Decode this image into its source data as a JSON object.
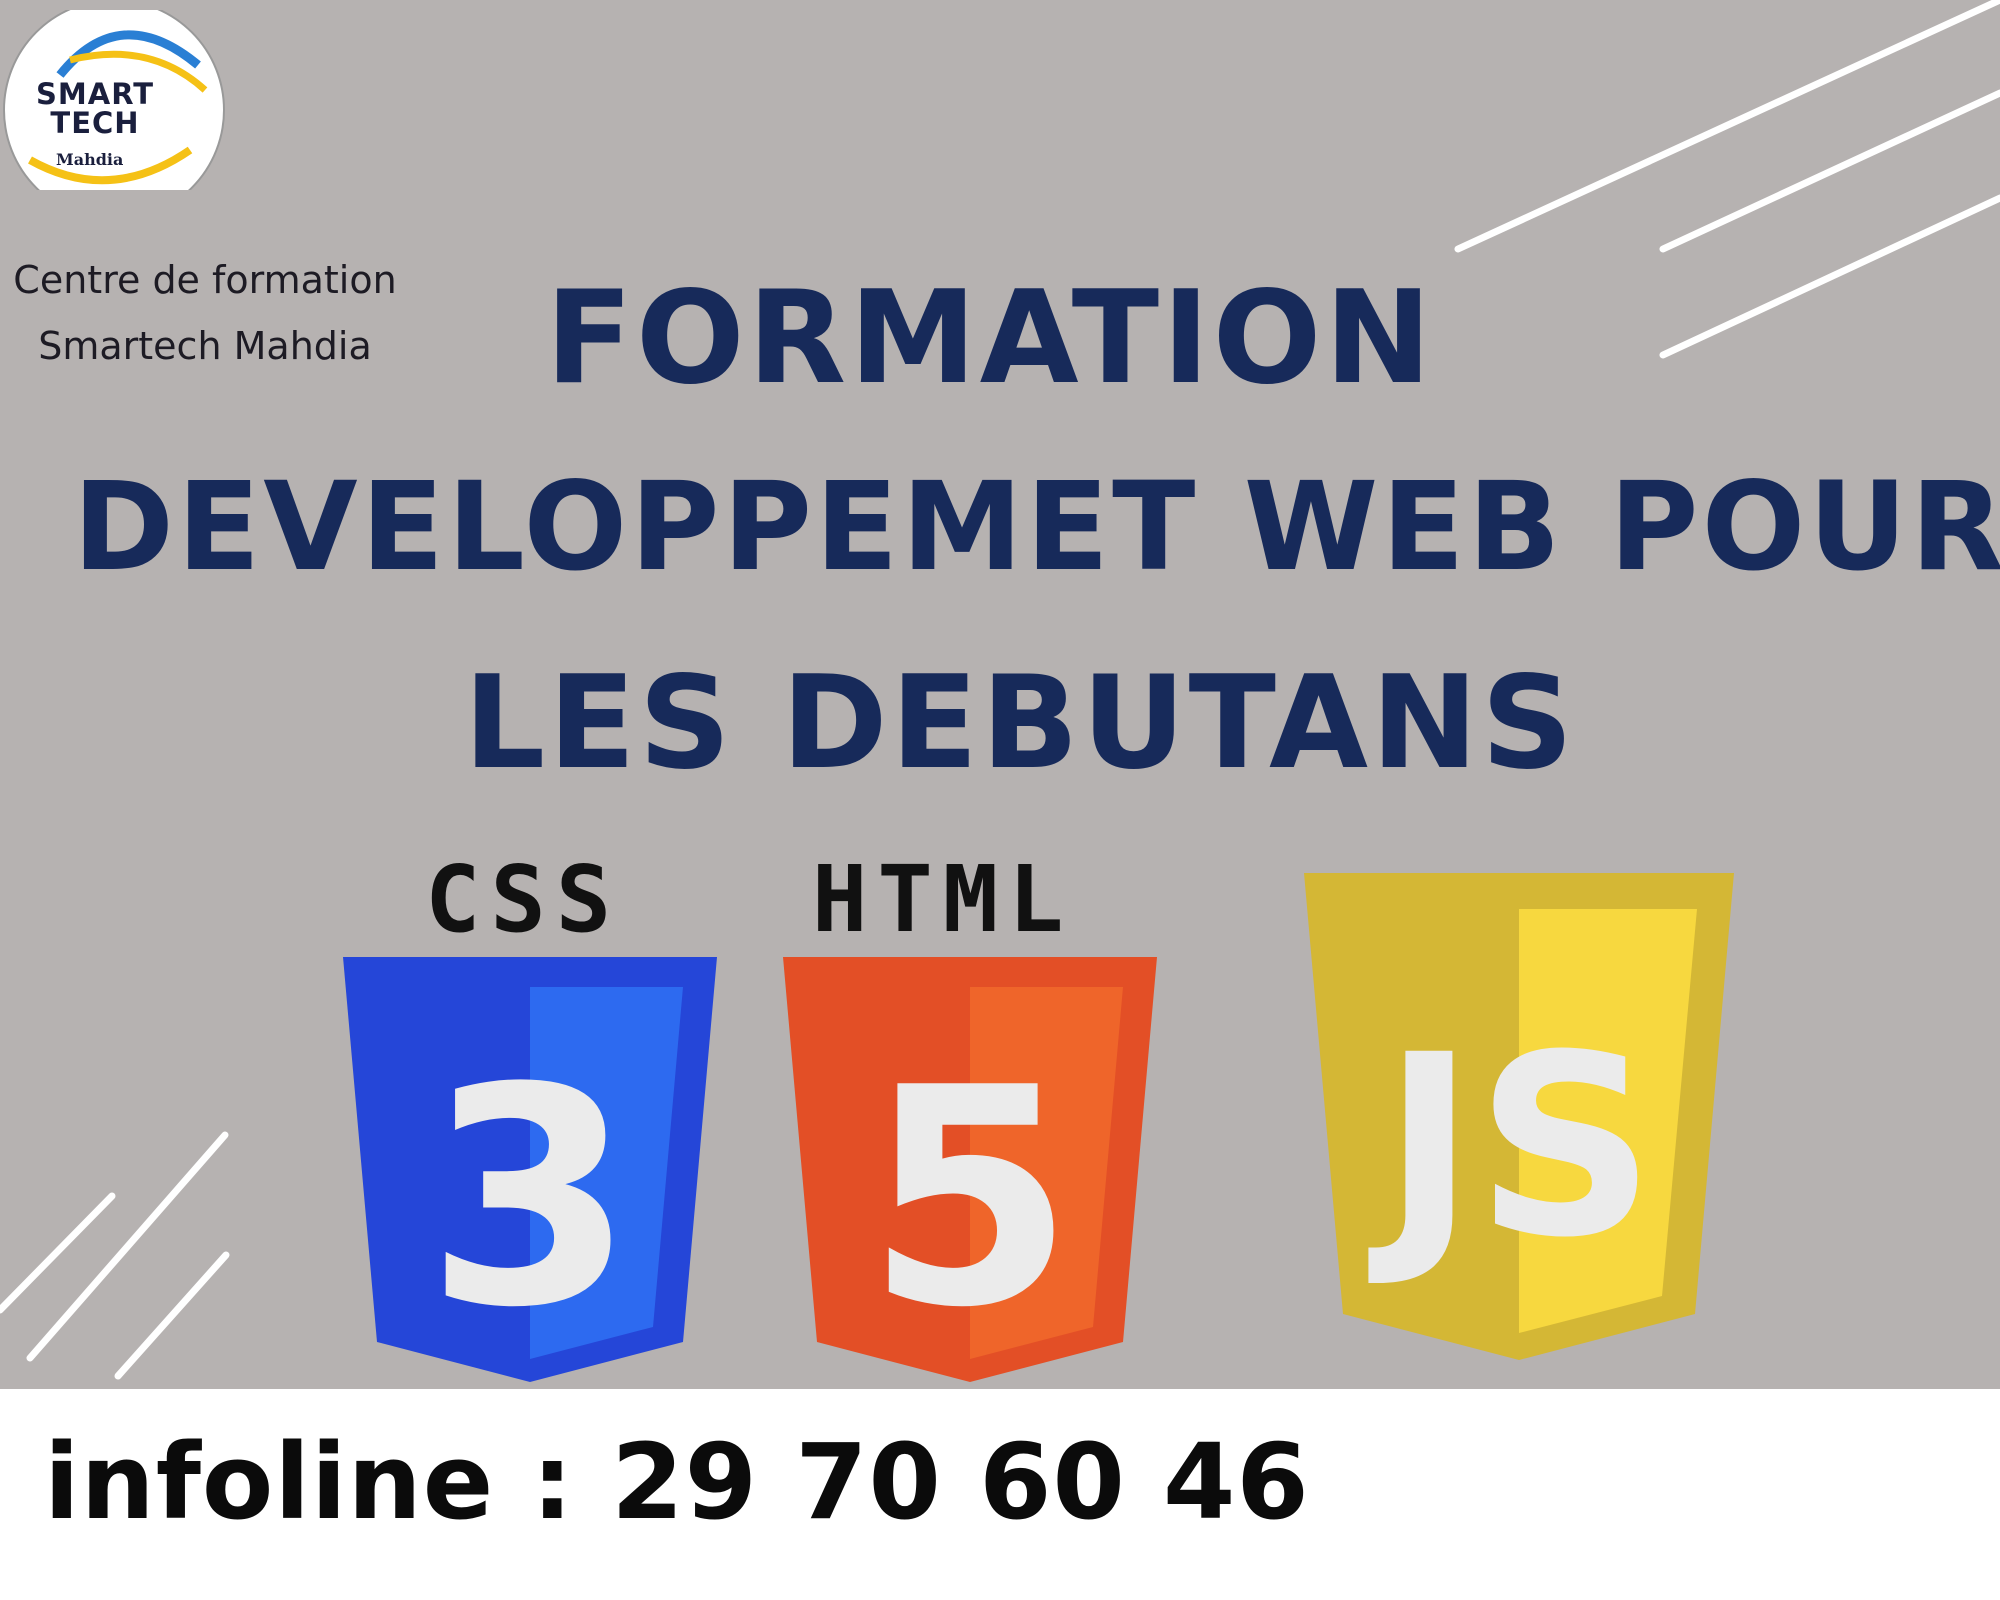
{
  "logo": {
    "line1": "SMART",
    "line2": "TECH",
    "subtitle": "Mahdia"
  },
  "center": {
    "line1": "Centre de formation",
    "line2": "Smartech Mahdia"
  },
  "headline": {
    "line1": "FORMATION",
    "line2": "DEVELOPPEMET WEB POUR",
    "line3": "LES DEBUTANS"
  },
  "technologies": {
    "css_label": "CSS",
    "html_label": "HTML",
    "css_glyph": "3",
    "html_glyph": "5",
    "js_glyph": "JS"
  },
  "colors": {
    "background": "#b6b2b1",
    "headline": "#172a5a",
    "css_blue": "#2a4fe0",
    "html_orange": "#e34f26",
    "js_yellow": "#d4b735"
  },
  "footer": {
    "infoline": "infoline : 29 70 60 46"
  }
}
